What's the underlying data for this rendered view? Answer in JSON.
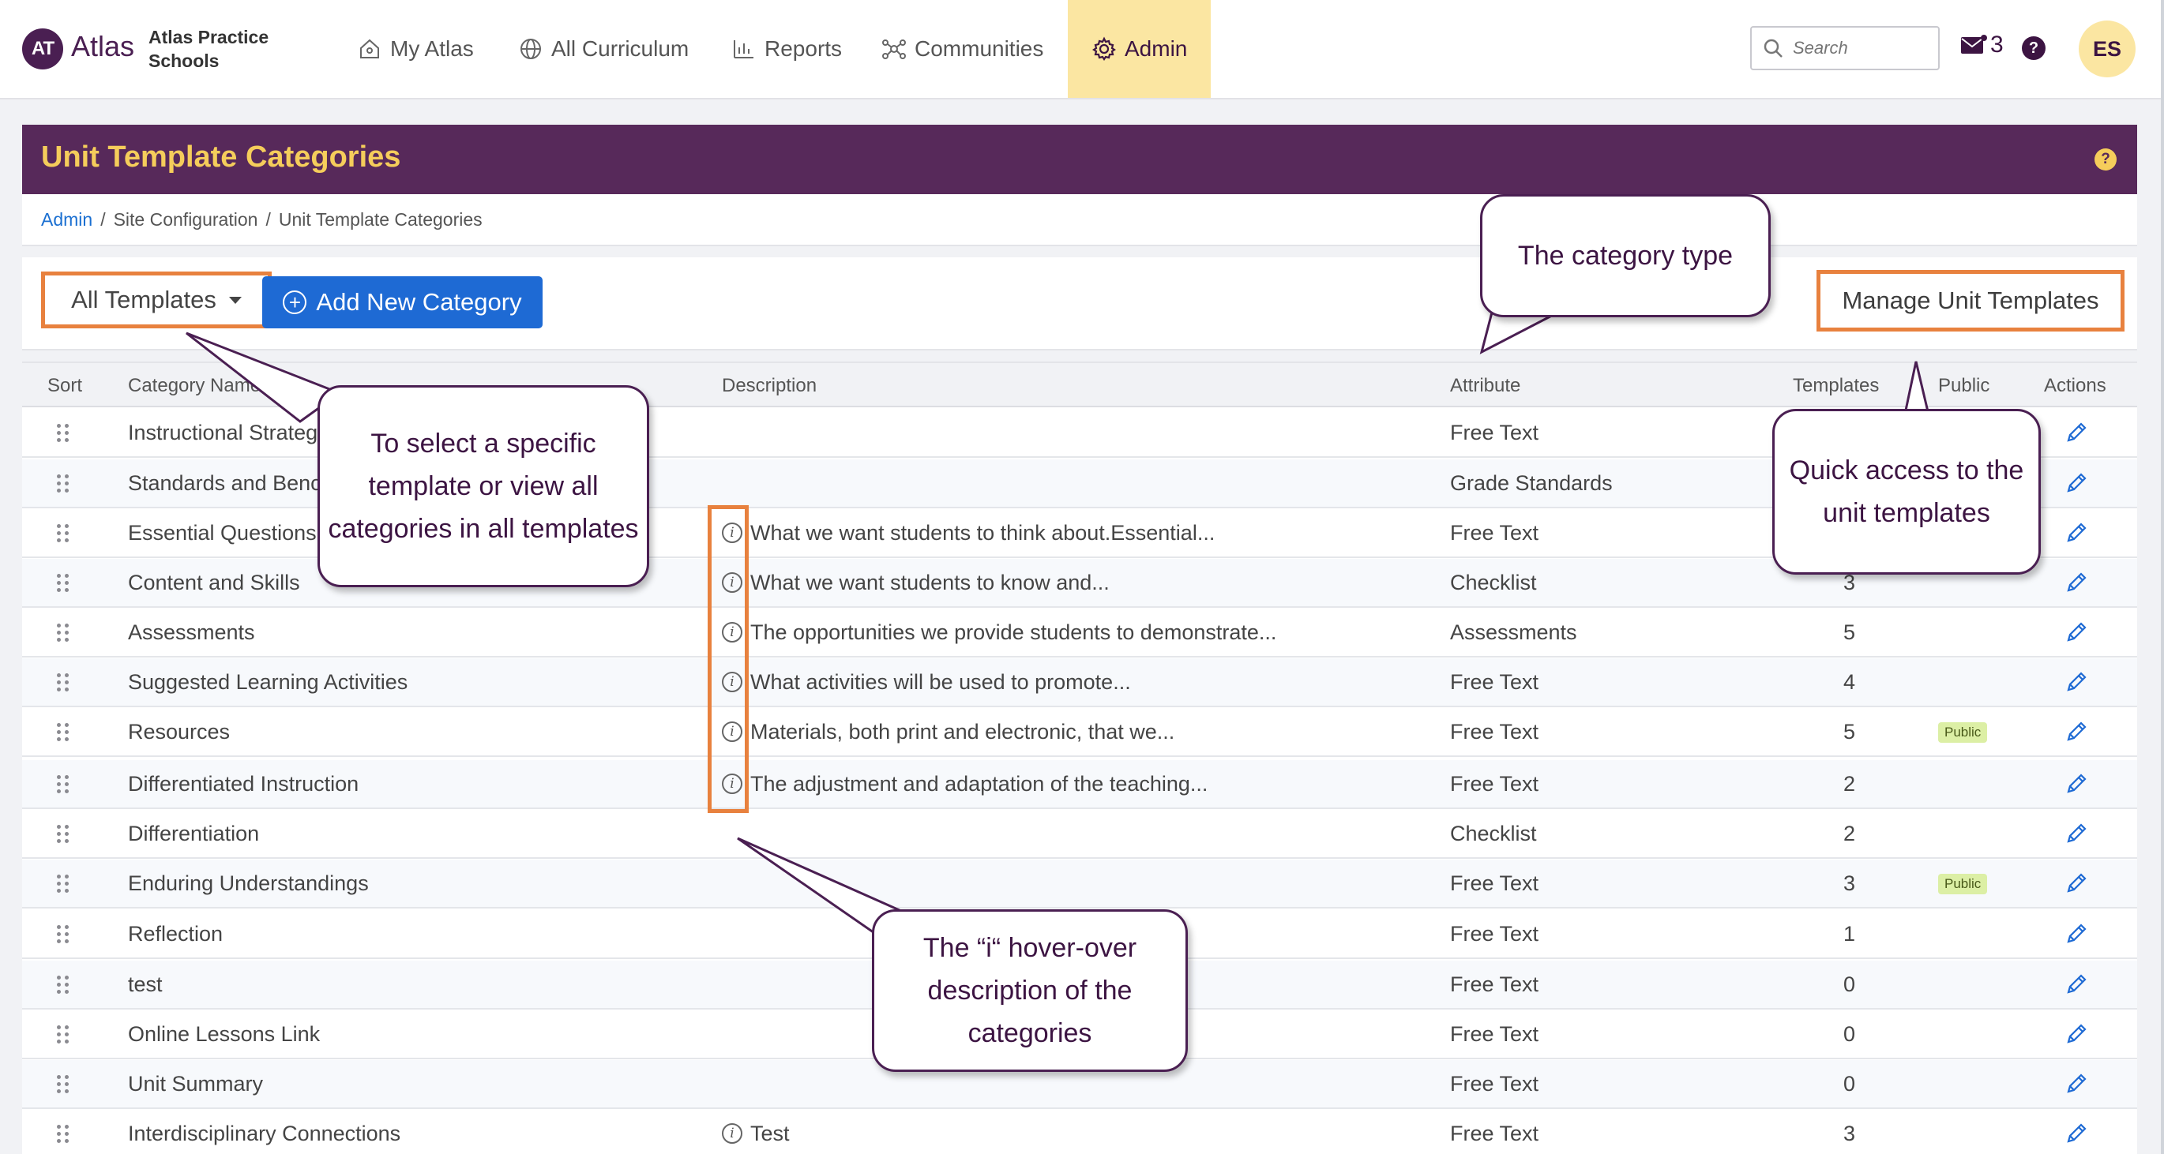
{
  "app": {
    "logo_initials": "AT",
    "logo_text": "Atlas",
    "school_name": "Atlas Practice Schools"
  },
  "nav": {
    "items": [
      {
        "label": "My Atlas",
        "icon": "home-icon"
      },
      {
        "label": "All Curriculum",
        "icon": "globe-icon"
      },
      {
        "label": "Reports",
        "icon": "bar-chart-icon"
      },
      {
        "label": "Communities",
        "icon": "network-icon"
      },
      {
        "label": "Admin",
        "icon": "gear-icon",
        "active": true
      }
    ],
    "search_placeholder": "Search",
    "mail_count": "3",
    "help_symbol": "?",
    "avatar_initials": "ES"
  },
  "page": {
    "title": "Unit Template Categories",
    "help_symbol": "?",
    "breadcrumb": [
      "Admin",
      "Site Configuration",
      "Unit Template Categories"
    ],
    "breadcrumb_separator": "/"
  },
  "toolbar": {
    "dropdown_label": "All Templates",
    "add_button_label": "Add New Category",
    "manage_button_label": "Manage Unit Templates"
  },
  "table": {
    "columns": {
      "sort": "Sort",
      "name": "Category Name",
      "description": "Description",
      "attribute": "Attribute",
      "templates": "Templates",
      "public": "Public",
      "actions": "Actions"
    },
    "rows": [
      {
        "name": "Instructional Strateg",
        "description": "",
        "attribute": "Free Text",
        "templates": "",
        "public": ""
      },
      {
        "name": "Standards and Benc",
        "description": "",
        "attribute": "Grade Standards",
        "templates": "",
        "public": ""
      },
      {
        "name": "Essential Questions",
        "description": "What we want students to think about.Essential...",
        "attribute": "Free Text",
        "templates": "",
        "public": ""
      },
      {
        "name": "Content and Skills",
        "description": "What we want students to know and...",
        "attribute": "Checklist",
        "templates": "3",
        "public": ""
      },
      {
        "name": "Assessments",
        "description": "The opportunities we provide students to demonstrate...",
        "attribute": "Assessments",
        "templates": "5",
        "public": ""
      },
      {
        "name": "Suggested Learning Activities",
        "description": "What activities will be used to promote...",
        "attribute": "Free Text",
        "templates": "4",
        "public": ""
      },
      {
        "name": "Resources",
        "description": "Materials, both print and electronic, that we...",
        "attribute": "Free Text",
        "templates": "5",
        "public": "Public"
      },
      {
        "name": "Differentiated Instruction",
        "description": "The adjustment and adaptation of the teaching...",
        "attribute": "Free Text",
        "templates": "2",
        "public": ""
      },
      {
        "name": "Differentiation",
        "description": "",
        "attribute": "Checklist",
        "templates": "2",
        "public": ""
      },
      {
        "name": "Enduring Understandings",
        "description": "",
        "attribute": "Free Text",
        "templates": "3",
        "public": "Public"
      },
      {
        "name": "Reflection",
        "description": "",
        "attribute": "Free Text",
        "templates": "1",
        "public": ""
      },
      {
        "name": "test",
        "description": "",
        "attribute": "Free Text",
        "templates": "0",
        "public": ""
      },
      {
        "name": "Online Lessons Link",
        "description": "",
        "attribute": "Free Text",
        "templates": "0",
        "public": ""
      },
      {
        "name": "Unit Summary",
        "description": "",
        "attribute": "Free Text",
        "templates": "0",
        "public": ""
      },
      {
        "name": "Interdisciplinary Connections",
        "description": "Test",
        "attribute": "Free Text",
        "templates": "3",
        "public": ""
      }
    ]
  },
  "callouts": {
    "category_type": "The category type",
    "select_template": "To select a specific template or view all categories in all templates",
    "quick_access": "Quick access to the unit templates",
    "hover_description": "The “i“ hover-over description of the categories"
  },
  "colors": {
    "brand_purple": "#57295a",
    "title_gold": "#f5cd5b",
    "active_nav": "#fbe6a2",
    "primary_button": "#1e6ad4",
    "highlight_orange": "#e8813e",
    "public_badge": "#dcefa5"
  }
}
